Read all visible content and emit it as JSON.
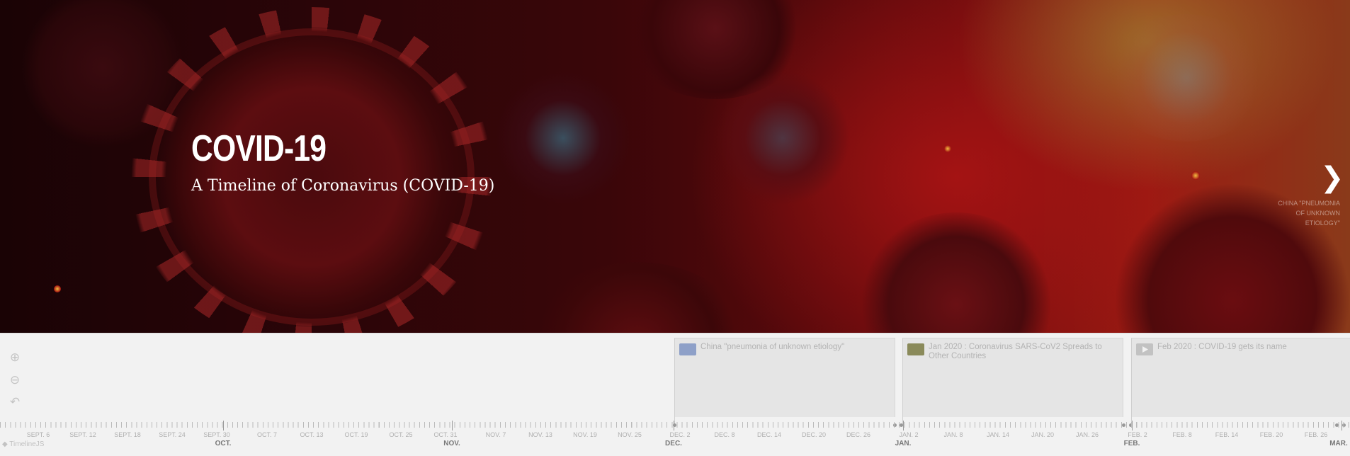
{
  "slide": {
    "title": "COVID-19",
    "subtitle": "A Timeline of Coronavirus (COVID-19)",
    "next_arrow": "❯",
    "next_label": "CHINA \"PNEUMONIA OF UNKNOWN ETIOLOGY\""
  },
  "zoom": {
    "in": "⊕",
    "out": "⊖",
    "back": "↶"
  },
  "events": [
    {
      "text": "China \"pneumonia of unknown etiology\"",
      "thumb_color": "#8ea0c8"
    },
    {
      "text": "Jan 2020 : Coronavirus SARS-CoV2 Spreads to Other Countries",
      "thumb_color": "#8a8a5a"
    },
    {
      "text": "Feb 2020 : COVID-19 gets its name",
      "thumb_color": "#c2c2c2"
    }
  ],
  "axis": {
    "minor": [
      "SEPT. 6",
      "SEPT. 12",
      "SEPT. 18",
      "SEPT. 24",
      "SEPT. 30",
      "OCT. 7",
      "OCT. 13",
      "OCT. 19",
      "OCT. 25",
      "OCT. 31",
      "NOV. 7",
      "NOV. 13",
      "NOV. 19",
      "NOV. 25",
      "DEC. 2",
      "DEC. 8",
      "DEC. 14",
      "DEC. 20",
      "DEC. 26",
      "JAN. 2",
      "JAN. 8",
      "JAN. 14",
      "JAN. 20",
      "JAN. 26",
      "FEB. 2",
      "FEB. 8",
      "FEB. 14",
      "FEB. 20",
      "FEB. 26"
    ],
    "major": [
      "OCT.",
      "NOV.",
      "DEC.",
      "JAN.",
      "FEB.",
      "MAR."
    ]
  },
  "attribution": "TimelineJS"
}
